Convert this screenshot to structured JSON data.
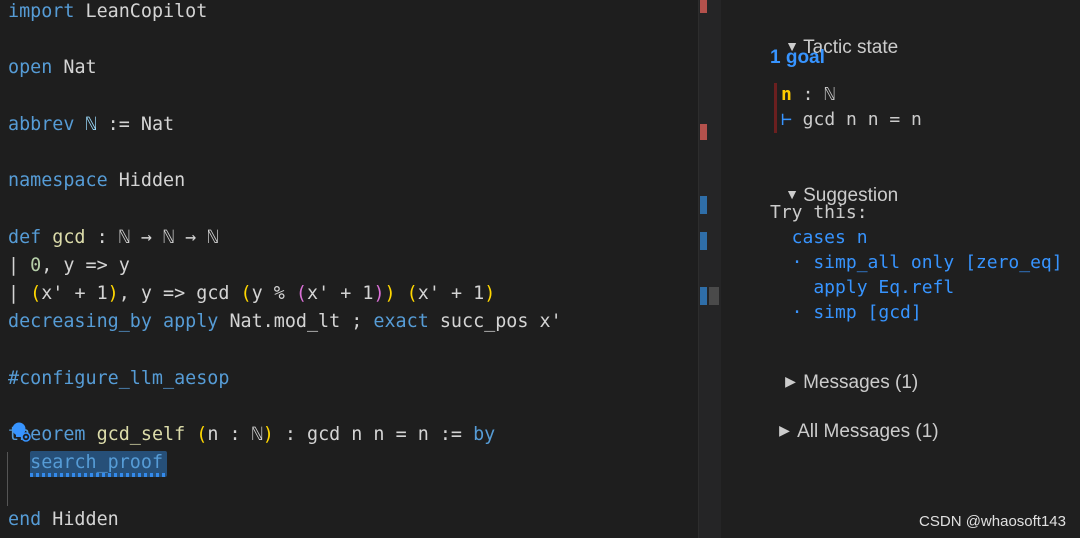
{
  "editor": {
    "lines": [
      {
        "tokens": [
          {
            "t": "import",
            "c": "kw"
          },
          {
            "t": " LeanCopilot",
            "c": "plain"
          }
        ]
      },
      {
        "tokens": []
      },
      {
        "tokens": [
          {
            "t": "open",
            "c": "kw"
          },
          {
            "t": " Nat",
            "c": "plain"
          }
        ]
      },
      {
        "tokens": []
      },
      {
        "tokens": [
          {
            "t": "abbrev",
            "c": "kw"
          },
          {
            "t": " ℕ ",
            "c": "id"
          },
          {
            "t": ":= Nat",
            "c": "plain"
          }
        ]
      },
      {
        "tokens": []
      },
      {
        "tokens": [
          {
            "t": "namespace",
            "c": "kw"
          },
          {
            "t": " Hidden",
            "c": "plain"
          }
        ]
      },
      {
        "tokens": []
      },
      {
        "tokens": [
          {
            "t": "def",
            "c": "kw"
          },
          {
            "t": " gcd",
            "c": "fn"
          },
          {
            "t": " : ℕ → ℕ → ℕ",
            "c": "plain"
          }
        ]
      },
      {
        "tokens": [
          {
            "t": "| ",
            "c": "plain"
          },
          {
            "t": "0",
            "c": "num"
          },
          {
            "t": ", y => y",
            "c": "plain"
          }
        ]
      },
      {
        "tokens": [
          {
            "t": "| ",
            "c": "plain"
          },
          {
            "t": "(",
            "c": "p1"
          },
          {
            "t": "x' + 1",
            "c": "plain"
          },
          {
            "t": ")",
            "c": "p1"
          },
          {
            "t": ", y => gcd ",
            "c": "plain"
          },
          {
            "t": "(",
            "c": "p1"
          },
          {
            "t": "y % ",
            "c": "plain"
          },
          {
            "t": "(",
            "c": "p2"
          },
          {
            "t": "x' + 1",
            "c": "plain"
          },
          {
            "t": ")",
            "c": "p2"
          },
          {
            "t": ")",
            "c": "p1"
          },
          {
            "t": " ",
            "c": "plain"
          },
          {
            "t": "(",
            "c": "p1"
          },
          {
            "t": "x' + 1",
            "c": "plain"
          },
          {
            "t": ")",
            "c": "p1"
          }
        ]
      },
      {
        "tokens": [
          {
            "t": "decreasing_by",
            "c": "kw"
          },
          {
            "t": " ",
            "c": "plain"
          },
          {
            "t": "apply",
            "c": "kw"
          },
          {
            "t": " Nat.mod_lt ; ",
            "c": "plain"
          },
          {
            "t": "exact",
            "c": "kw"
          },
          {
            "t": " succ_pos x'",
            "c": "plain"
          }
        ]
      },
      {
        "tokens": []
      },
      {
        "tokens": [
          {
            "t": "#configure_llm_aesop",
            "c": "kw"
          }
        ]
      },
      {
        "tokens": []
      },
      {
        "tokens": [
          {
            "t": "theorem",
            "c": "kw"
          },
          {
            "t": " gcd_self",
            "c": "fn"
          },
          {
            "t": " ",
            "c": "plain"
          },
          {
            "t": "(",
            "c": "p1"
          },
          {
            "t": "n : ℕ",
            "c": "plain"
          },
          {
            "t": ")",
            "c": "p1"
          },
          {
            "t": " : gcd n n = n := ",
            "c": "plain"
          },
          {
            "t": "by",
            "c": "kw"
          }
        ]
      },
      {
        "tokens": [
          {
            "t": "  ",
            "c": "plain"
          },
          {
            "t": "search_proof",
            "c": "kw"
          }
        ]
      },
      {
        "tokens": []
      },
      {
        "tokens": [
          {
            "t": "end",
            "c": "kw"
          },
          {
            "t": " Hidden",
            "c": "plain"
          }
        ]
      }
    ]
  },
  "infoview": {
    "tactic_state": {
      "label": "Tactic state",
      "goal_count": "1 goal",
      "hyp_name": "n",
      "hyp_type": " : ℕ",
      "turnstile": "⊢",
      "goal": " gcd n n = n"
    },
    "suggestion": {
      "label": "Suggestion",
      "try_this": "Try this:",
      "lines": [
        "  cases n",
        "  · simp_all only [zero_eq]",
        "    apply Eq.refl",
        "  · simp [gcd]"
      ]
    },
    "messages": {
      "label": "Messages (1)"
    },
    "all_messages": {
      "label": "All Messages (1)"
    },
    "caret_open": "▼",
    "caret_closed": "▶"
  },
  "watermark": "CSDN @whaosoft143"
}
